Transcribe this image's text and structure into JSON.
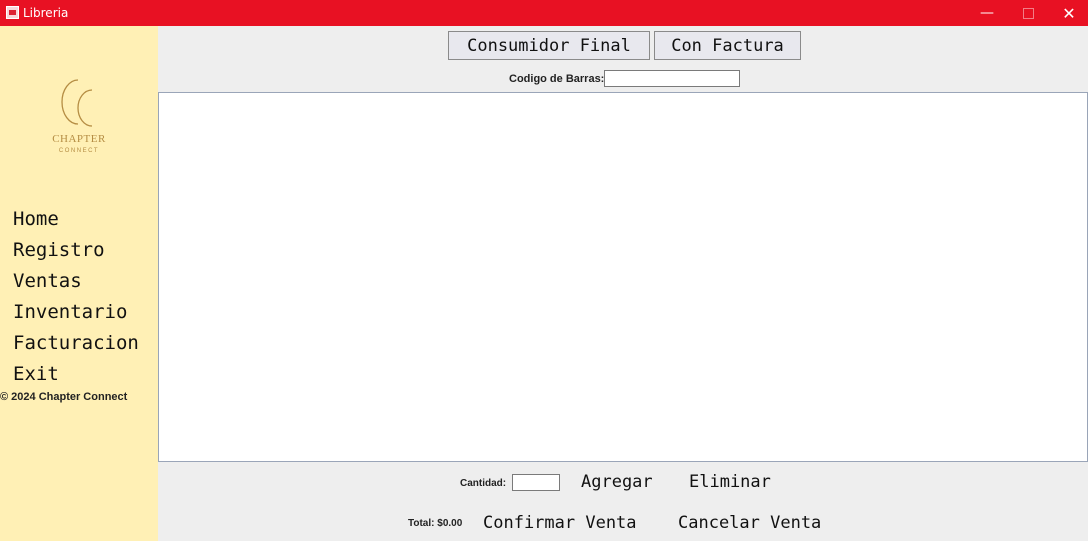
{
  "window": {
    "title": "Libreria",
    "minimize_icon": "minimize-icon",
    "maximize_icon": "maximize-icon",
    "close_icon": "close-icon"
  },
  "sidebar": {
    "logo": {
      "monogram": "CC",
      "name": "CHAPTER",
      "subname": "CONNECT",
      "color": "#b58d43"
    },
    "items": [
      {
        "label": "Home"
      },
      {
        "label": "Registro"
      },
      {
        "label": "Ventas"
      },
      {
        "label": "Inventario"
      },
      {
        "label": "Facturacion"
      },
      {
        "label": "Exit"
      }
    ],
    "copyright": "© 2024 Chapter Connect",
    "background": "#fff0b5"
  },
  "toolbar": {
    "consumidor_final": "Consumidor Final",
    "con_factura": "Con Factura"
  },
  "barcode": {
    "label": "Codigo de Barras:",
    "value": ""
  },
  "quantity": {
    "label": "Cantidad:",
    "value": ""
  },
  "actions": {
    "agregar": "Agregar",
    "eliminar": "Eliminar",
    "confirmar": "Confirmar Venta",
    "cancelar": "Cancelar Venta"
  },
  "total": {
    "label": "Total: $0.00"
  },
  "colors": {
    "titlebar": "#e81123"
  }
}
